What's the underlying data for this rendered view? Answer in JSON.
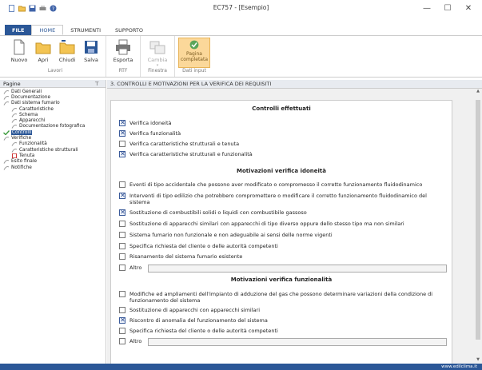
{
  "window": {
    "title": "EC757 - [Esempio]",
    "minimize": "—",
    "maximize": "☐",
    "close": "✕"
  },
  "tabs": {
    "file": "FILE",
    "home": "HOME",
    "strumenti": "STRUMENTI",
    "supporto": "SUPPORTO"
  },
  "ribbon": {
    "nuovo": "Nuovo",
    "apri": "Apri",
    "chiudi": "Chiudi",
    "salva": "Salva",
    "lavori": "Lavori",
    "esporta": "Esporta",
    "rtf": "RTF",
    "cambia": "Cambia",
    "finestra": "Finestra",
    "pagina_completata": "Pagina completata",
    "dati_input": "Dati input"
  },
  "left_panel": {
    "header": "Pagine",
    "pin": "⊤",
    "items": [
      {
        "label": "Dati Generali",
        "level": 0,
        "icon": "page"
      },
      {
        "label": "Documentazione",
        "level": 0,
        "icon": "page"
      },
      {
        "label": "Dati sistema fumario",
        "level": 0,
        "icon": "page"
      },
      {
        "label": "Caratteristiche",
        "level": 1,
        "icon": "page"
      },
      {
        "label": "Schema",
        "level": 1,
        "icon": "page"
      },
      {
        "label": "Apparecchi",
        "level": 1,
        "icon": "page"
      },
      {
        "label": "Documentazione fotografica",
        "level": 1,
        "icon": "page"
      },
      {
        "label": "Controlli",
        "level": 0,
        "icon": "check",
        "selected": true
      },
      {
        "label": "Verifiche",
        "level": 0,
        "icon": "page"
      },
      {
        "label": "Funzionalità",
        "level": 1,
        "icon": "page"
      },
      {
        "label": "Caratteristiche strutturali",
        "level": 1,
        "icon": "page"
      },
      {
        "label": "Tenuta",
        "level": 1,
        "icon": "doc-red"
      },
      {
        "label": "Esito finale",
        "level": 0,
        "icon": "page"
      },
      {
        "label": "Notifiche",
        "level": 0,
        "icon": "page"
      }
    ]
  },
  "main": {
    "header": "3. CONTROLLI E MOTIVAZIONI PER LA VERIFICA DEI REQUISITI",
    "sec1_title": "Controlli effettuati",
    "sec1": [
      {
        "label": "Verifica idoneità",
        "checked": true
      },
      {
        "label": "Verifica funzionalità",
        "checked": true
      },
      {
        "label": "Verifica caratteristiche strutturali e tenuta",
        "checked": false
      },
      {
        "label": "Verifica caratteristiche strutturali e funzionalità",
        "checked": true
      }
    ],
    "sec2_title": "Motivazioni verifica idoneità",
    "sec2": [
      {
        "label": "Eventi di tipo accidentale che possono aver modificato o compromesso il corretto funzionamento fluidodinamico",
        "checked": false
      },
      {
        "label": "Interventi di tipo edilizio che potrebbero compromettere o modificare il corretto funzionamento fluidodinamico del sistema",
        "checked": true
      },
      {
        "label": "Sostituzione di combustibili solidi o liquidi con combustibile gassoso",
        "checked": true
      },
      {
        "label": "Sostituzione di apparecchi similari con apparecchi di tipo diverso oppure dello stesso tipo ma non similari",
        "checked": false
      },
      {
        "label": "Sistema fumario non funzionale e non adeguabile ai sensi delle norme vigenti",
        "checked": false
      },
      {
        "label": "Specifica richiesta del cliente o delle autorità competenti",
        "checked": false
      },
      {
        "label": "Risanamento del sistema fumario esistente",
        "checked": false
      }
    ],
    "sec2_altro": "Altro",
    "sec3_title": "Motivazioni verifica funzionalità",
    "sec3": [
      {
        "label": "Modifiche ed ampliamenti dell'impianto di adduzione del gas che possono determinare variazioni della condizione di funzionamento del sistema",
        "checked": false
      },
      {
        "label": "Sostituzione di apparecchi con apparecchi similari",
        "checked": false
      },
      {
        "label": "Riscontro di anomalia del funzionamento del sistema",
        "checked": true
      },
      {
        "label": "Specifica richiesta del cliente o delle autorità competenti",
        "checked": false
      }
    ],
    "sec3_altro": "Altro"
  },
  "statusbar": {
    "text": "www.edilclima.it"
  },
  "colors": {
    "accent": "#2b5797",
    "highlight": "#fbd89a"
  }
}
